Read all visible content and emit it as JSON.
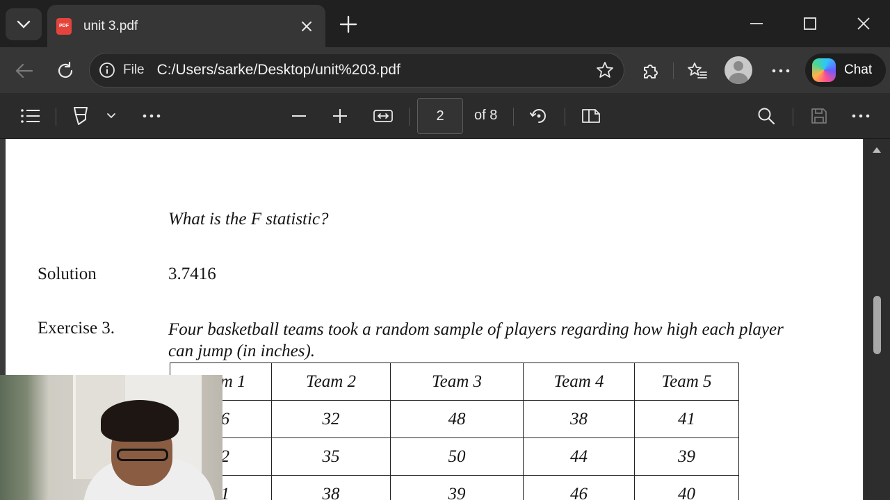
{
  "browser": {
    "tab": {
      "title": "unit 3.pdf",
      "favicon_text": "PDF"
    },
    "address": {
      "scheme": "File",
      "url": "C:/Users/sarke/Desktop/unit%203.pdf"
    },
    "chat_label": "Chat",
    "icons": [
      "tab-list-icon",
      "close-icon",
      "plus-icon",
      "minimize-icon",
      "maximize-icon",
      "back-icon",
      "refresh-icon",
      "info-icon",
      "star-icon",
      "extensions-icon",
      "favorites-icon",
      "profile-icon",
      "more-icon",
      "copilot-icon"
    ]
  },
  "pdf_toolbar": {
    "current_page": "2",
    "page_count_label": "of 8",
    "icons": [
      "contents-icon",
      "draw-icon",
      "chevron-down-icon",
      "more-icon",
      "zoom-out-icon",
      "zoom-in-icon",
      "fit-width-icon",
      "rotate-icon",
      "page-view-icon",
      "search-icon",
      "save-icon",
      "more-icon"
    ]
  },
  "document": {
    "question": "What is the F statistic?",
    "solution_label": "Solution",
    "solution_value": "3.7416",
    "exercise_label": "Exercise 3.",
    "exercise_text": "Four basketball teams took a random sample of players regarding how high each player can jump (in inches).",
    "table": {
      "headers": [
        "Team 1",
        "Team 2",
        "Team 3",
        "Team 4",
        "Team 5"
      ],
      "rows": [
        [
          "36",
          "32",
          "48",
          "38",
          "41"
        ],
        [
          "42",
          "35",
          "50",
          "44",
          "39"
        ],
        [
          "51",
          "38",
          "39",
          "46",
          "40"
        ]
      ]
    }
  }
}
